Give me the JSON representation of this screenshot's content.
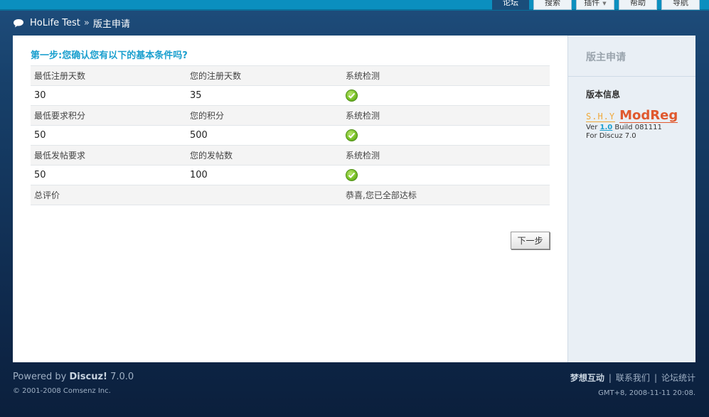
{
  "nav": {
    "tabs": [
      {
        "label": "论坛",
        "active": true
      },
      {
        "label": "搜索",
        "active": false
      },
      {
        "label": "插件",
        "active": false,
        "dropdown": true
      },
      {
        "label": "帮助",
        "active": false
      },
      {
        "label": "导航",
        "active": false
      }
    ]
  },
  "breadcrumb": {
    "home": "HoLife Test",
    "separator": "»",
    "current": "版主申请"
  },
  "main": {
    "step_title": "第一步:您确认您有以下的基本条件吗?",
    "rows": [
      {
        "h1": "最低注册天数",
        "h2": "您的注册天数",
        "h3": "系统检测",
        "v1": "30",
        "v2": "35",
        "check": "check-icon"
      },
      {
        "h1": "最低要求积分",
        "h2": "您的积分",
        "h3": "系统检测",
        "v1": "50",
        "v2": "500",
        "check": "check-icon"
      },
      {
        "h1": "最低发帖要求",
        "h2": "您的发帖数",
        "h3": "系统检测",
        "v1": "50",
        "v2": "100",
        "check": "check-icon"
      }
    ],
    "summary_label": "总评价",
    "summary_value": "恭喜,您已全部达标",
    "next_button": "下一步"
  },
  "side": {
    "title": "版主申请",
    "info_header": "版本信息",
    "logo_shy": "S.H.Y",
    "logo_modreg": "ModReg",
    "ver_prefix": "Ver",
    "ver_num": "1.0",
    "ver_build": "Build 081111",
    "for_text": "For Discuz 7.0"
  },
  "footer": {
    "powered_prefix": "Powered by",
    "powered_brand": "Discuz!",
    "powered_version": "7.0.0",
    "copyright": "© 2001-2008 Comsenz Inc.",
    "links": [
      "梦想互动",
      "联系我们",
      "论坛统计"
    ],
    "time": "GMT+8, 2008-11-11 20:08."
  },
  "colors": {
    "accent": "#1a9fce",
    "topbar": "#0b8fbf",
    "logo_orange": "#e0592e"
  }
}
